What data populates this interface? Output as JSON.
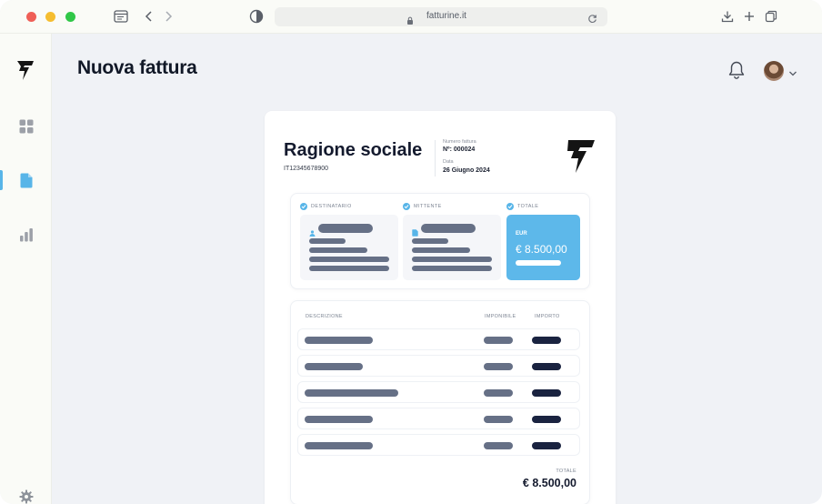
{
  "browser": {
    "url": "fatturine.it",
    "traffic_light_colors": [
      "#ef5f57",
      "#f5bd30",
      "#30c748"
    ]
  },
  "sidebar": {
    "items": [
      {
        "name": "dashboard",
        "icon": "grid-icon",
        "active": false
      },
      {
        "name": "invoices",
        "icon": "document-icon",
        "active": true
      },
      {
        "name": "reports",
        "icon": "bar-chart-icon",
        "active": false
      }
    ],
    "footer_icon": "gear-icon"
  },
  "header": {
    "title": "Nuova fattura",
    "notification_icon": "bell-icon"
  },
  "invoice": {
    "company_name": "Ragione sociale",
    "vat_number": "IT12345678900",
    "number_label": "Numero fattura",
    "number_value": "Nº: 000024",
    "date_label": "Data",
    "date_value": "26 Giugno 2024",
    "recipient_label": "DESTINATARIO",
    "sender_label": "MITTENTE",
    "total_label": "TOTALE",
    "currency": "EUR",
    "total_amount": "€ 8.500,00",
    "columns": {
      "description": "DESCRIZIONE",
      "taxable": "IMPONIBILE",
      "amount": "IMPORTO"
    },
    "line_item_count": 5,
    "summary_label": "TOTALE",
    "summary_amount": "€ 8.500,00"
  },
  "colors": {
    "accent": "#58b5e8",
    "total_card": "#5db8ea",
    "placeholder": "#667086",
    "placeholder_dark": "#1a2340",
    "text_dark": "#141a2e"
  }
}
